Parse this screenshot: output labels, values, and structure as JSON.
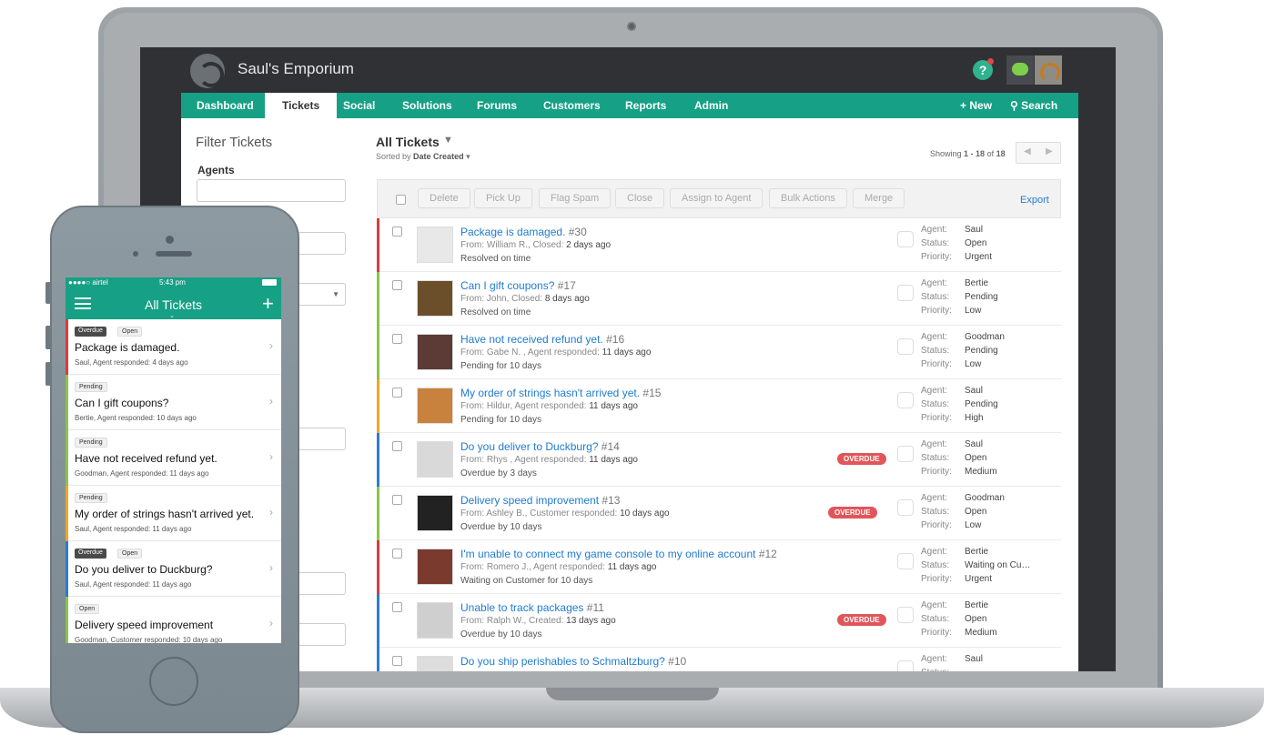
{
  "app": {
    "brand": "Saul's Emporium",
    "help_icon": "?",
    "icons": [
      "help-icon",
      "chat-icon",
      "avatar"
    ]
  },
  "nav": {
    "items": [
      "Dashboard",
      "Tickets",
      "Social",
      "Solutions",
      "Forums",
      "Customers",
      "Reports",
      "Admin"
    ],
    "active": "Tickets",
    "new_label": "New",
    "search_label": "Search"
  },
  "filter": {
    "title": "Filter Tickets",
    "agents_label": "Agents"
  },
  "list": {
    "title": "All Tickets",
    "sorted_by_prefix": "Sorted by",
    "sorted_by_value": "Date Created",
    "showing_prefix": "Showing",
    "showing_range": "1 - 18",
    "showing_of": "of",
    "showing_total": "18"
  },
  "actions": {
    "buttons": [
      "Delete",
      "Pick Up",
      "Flag Spam",
      "Close",
      "Assign to Agent",
      "Bulk Actions",
      "Merge"
    ],
    "export": "Export"
  },
  "meta_labels": {
    "agent": "Agent:",
    "status": "Status:",
    "priority": "Priority:"
  },
  "overdue_label": "OVERDUE",
  "tickets": [
    {
      "subject": "Package is damaged.",
      "num": "#30",
      "from_label": "From:",
      "from": "William R., Closed:",
      "time": "2 days ago",
      "state": "Resolved on time",
      "agent": "Saul",
      "status": "Open",
      "priority": "Urgent",
      "color": "#e0393e",
      "overdue": false,
      "thumb": "#e8e8e8"
    },
    {
      "subject": "Can I gift coupons?",
      "num": "#17",
      "from_label": "From:",
      "from": "John, Closed:",
      "time": "8 days ago",
      "state": "Resolved on time",
      "agent": "Bertie",
      "status": "Pending",
      "priority": "Low",
      "color": "#8bc34a",
      "overdue": false,
      "thumb": "#6b4f2a"
    },
    {
      "subject": "Have not received refund yet.",
      "num": "#16",
      "from_label": "From:",
      "from": "Gabe N. , Agent responded:",
      "time": "11 days ago",
      "state": "Pending for 10 days",
      "agent": "Goodman",
      "status": "Pending",
      "priority": "Low",
      "color": "#8bc34a",
      "overdue": false,
      "thumb": "#5c3a36"
    },
    {
      "subject": "My order of strings hasn't arrived yet.",
      "num": "#15",
      "from_label": "From:",
      "from": "Hildur, Agent responded:",
      "time": "11 days ago",
      "state": "Pending for 10 days",
      "agent": "Saul",
      "status": "Pending",
      "priority": "High",
      "color": "#f5a623",
      "overdue": false,
      "thumb": "#c9823d"
    },
    {
      "subject": "Do you deliver to Duckburg?",
      "num": "#14",
      "from_label": "From:",
      "from": "Rhys , Agent responded:",
      "time": "11 days ago",
      "state": "Overdue by 3 days",
      "agent": "Saul",
      "status": "Open",
      "priority": "Medium",
      "color": "#2b7bd4",
      "overdue": true,
      "thumb": "#d9d9d9"
    },
    {
      "subject": "Delivery speed improvement",
      "num": "#13",
      "from_label": "From:",
      "from": "Ashley B., Customer responded:",
      "time": "10 days ago",
      "state": "Overdue by 10 days",
      "agent": "Goodman",
      "status": "Open",
      "priority": "Low",
      "color": "#8bc34a",
      "overdue": true,
      "thumb": "#222222"
    },
    {
      "subject": "I'm unable to connect my game console to my online account",
      "num": "#12",
      "from_label": "From:",
      "from": "Romero J., Agent responded:",
      "time": "11 days ago",
      "state": "Waiting on Customer for 10 days",
      "agent": "Bertie",
      "status": "Waiting on Cu…",
      "priority": "Urgent",
      "color": "#e0393e",
      "overdue": false,
      "thumb": "#7a3a2e"
    },
    {
      "subject": "Unable to track packages",
      "num": "#11",
      "from_label": "From:",
      "from": "Ralph W., Created:",
      "time": "13 days ago",
      "state": "Overdue by 10 days",
      "agent": "Bertie",
      "status": "Open",
      "priority": "Medium",
      "color": "#2b7bd4",
      "overdue": true,
      "thumb": "#cfcfcf"
    },
    {
      "subject": "Do you ship perishables to Schmaltzburg?",
      "num": "#10",
      "from_label": "",
      "from": "",
      "time": "",
      "state": "",
      "agent": "Saul",
      "status": "",
      "priority": "",
      "color": "#2b7bd4",
      "overdue": false,
      "thumb": "#dddddd"
    }
  ],
  "phone": {
    "carrier": "●●●●○ airtel",
    "time": "5:43 pm",
    "title": "All Tickets",
    "plus": "+",
    "rows": [
      {
        "badges": [
          "Overdue",
          "Open"
        ],
        "subject": "Package is damaged.",
        "meta": "Saul, Agent responded: 4 days ago",
        "color": "#e0393e"
      },
      {
        "badges": [
          "Pending"
        ],
        "subject": "Can I gift coupons?",
        "meta": "Bertie, Agent responded: 10 days ago",
        "color": "#8bc34a"
      },
      {
        "badges": [
          "Pending"
        ],
        "subject": "Have not received refund yet.",
        "meta": "Goodman, Agent responded: 11 days ago",
        "color": "#8bc34a"
      },
      {
        "badges": [
          "Pending"
        ],
        "subject": "My order of strings hasn't arrived yet.",
        "meta": "Saul, Agent responded: 11 days ago",
        "color": "#f5a623"
      },
      {
        "badges": [
          "Overdue",
          "Open"
        ],
        "subject": "Do you deliver to Duckburg?",
        "meta": "Saul, Agent responded: 11 days ago",
        "color": "#2b7bd4"
      },
      {
        "badges": [
          "Open"
        ],
        "subject": "Delivery speed improvement",
        "meta": "Goodman, Customer responded: 10 days ago",
        "color": "#8bc34a"
      }
    ]
  }
}
